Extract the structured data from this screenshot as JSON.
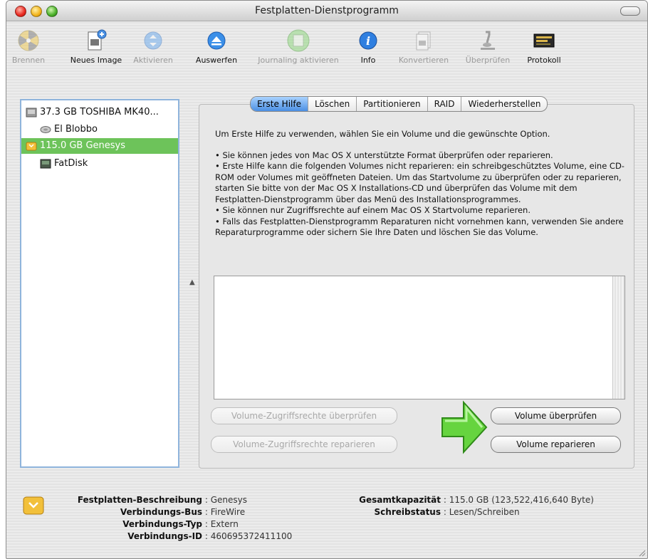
{
  "window": {
    "title": "Festplatten-Dienstprogramm"
  },
  "toolbar": {
    "items": [
      {
        "label": "Brennen",
        "icon": "burn-icon",
        "enabled": false
      },
      {
        "label": "Neues Image",
        "icon": "new-image-icon",
        "enabled": true
      },
      {
        "label": "Aktivieren",
        "icon": "mount-icon",
        "enabled": false
      },
      {
        "label": "Auswerfen",
        "icon": "eject-icon",
        "enabled": true
      },
      {
        "label": "Journaling aktivieren",
        "icon": "journaling-icon",
        "enabled": false
      },
      {
        "label": "Info",
        "icon": "info-icon",
        "enabled": true
      },
      {
        "label": "Konvertieren",
        "icon": "convert-icon",
        "enabled": false
      },
      {
        "label": "Überprüfen",
        "icon": "verify-icon",
        "enabled": false
      },
      {
        "label": "Protokoll",
        "icon": "log-icon",
        "enabled": true
      }
    ]
  },
  "sidebar": {
    "items": [
      {
        "label": "37.3 GB TOSHIBA MK40...",
        "icon": "internal-disk-icon",
        "selected": false
      },
      {
        "label": "El Blobbo",
        "icon": "volume-icon",
        "selected": false
      },
      {
        "label": "115.0 GB Genesys",
        "icon": "external-disk-icon",
        "selected": true
      },
      {
        "label": "FatDisk",
        "icon": "volume-icon",
        "selected": false
      }
    ]
  },
  "tabs": [
    "Erste Hilfe",
    "Löschen",
    "Partitionieren",
    "RAID",
    "Wiederherstellen"
  ],
  "active_tab": "Erste Hilfe",
  "first_aid": {
    "intro": "Um Erste Hilfe zu verwenden, wählen Sie ein Volume und die gewünschte Option.",
    "bullets": [
      "• Sie können jedes von Mac OS X unterstützte Format überprüfen oder reparieren.",
      "• Erste Hilfe kann die folgenden Volumes nicht reparieren: ein schreibgeschütztes Volume, eine CD-ROM oder Volumes mit geöffneten Dateien. Um das Startvolume zu überprüfen oder zu reparieren, starten Sie bitte von der Mac OS X Installations-CD und überprüfen das Volume mit dem Festplatten-Dienstprogramm über das Menü des Installationsprogrammes.",
      "• Sie können nur Zugriffsrechte auf einem Mac OS X Startvolume reparieren.",
      "• Falls das Festplatten-Dienstprogramm Reparaturen nicht vornehmen kann, verwenden Sie andere Reparaturprogramme oder sichern Sie Ihre Daten und löschen Sie das Volume."
    ],
    "buttons": {
      "verify_permissions": "Volume-Zugriffsrechte überprüfen",
      "repair_permissions": "Volume-Zugriffsrechte reparieren",
      "verify_volume": "Volume überprüfen",
      "repair_volume": "Volume reparieren"
    }
  },
  "disk_info": {
    "description_label": "Festplatten-Beschreibung",
    "description_value": "Genesys",
    "bus_label": "Verbindungs-Bus",
    "bus_value": "FireWire",
    "type_label": "Verbindungs-Typ",
    "type_value": "Extern",
    "id_label": "Verbindungs-ID",
    "id_value": "460695372411100",
    "capacity_label": "Gesamtkapazität",
    "capacity_value": "115.0 GB (123,522,416,640 Byte)",
    "write_label": "Schreibstatus",
    "write_value": "Lesen/Schreiben",
    "separator": ":"
  },
  "colors": {
    "selection": "#6dc35a",
    "active_tab": "#4b8fe3",
    "arrow": "#5fd13c"
  }
}
